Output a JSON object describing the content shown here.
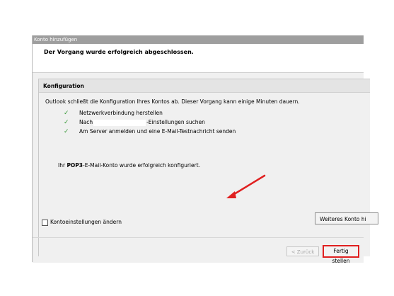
{
  "window": {
    "title": "Konto hinzufügen",
    "header": "Der Vorgang wurde erfolgreich abgeschlossen."
  },
  "config": {
    "title": "Konfiguration",
    "intro": "Outlook schließt die Konfiguration Ihres Kontos ab. Dieser Vorgang kann einige Minuten dauern.",
    "steps": [
      {
        "icon": "checkmark-icon",
        "prefix": "Netzwerkverbindung herstellen",
        "suffix": ""
      },
      {
        "icon": "checkmark-icon",
        "prefix": "Nach",
        "suffix": "-Einstellungen suchen"
      },
      {
        "icon": "checkmark-icon",
        "prefix": "Am Server anmelden und eine E-Mail-Testnachricht senden",
        "suffix": ""
      }
    ],
    "success_prefix": "Ihr ",
    "success_bold": "POP3",
    "success_suffix": "-E-Mail-Konto wurde erfolgreich konfiguriert."
  },
  "controls": {
    "checkbox_label": "Kontoeinstellungen ändern",
    "checkbox_checked": false,
    "more_button": "Weiteres Konto hi",
    "back_button": "< Zurück",
    "finish_button": "Fertig stellen"
  },
  "colors": {
    "highlight": "#e02020",
    "check": "#3a9a3a"
  }
}
